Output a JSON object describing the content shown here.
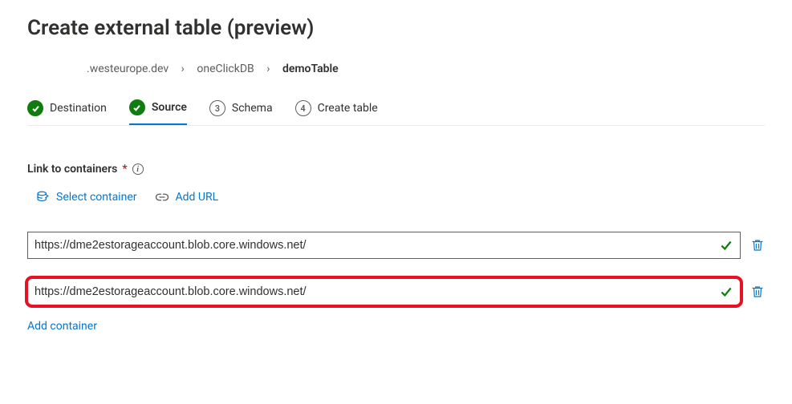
{
  "title": "Create external table (preview)",
  "breadcrumb": {
    "cluster": ".westeurope.dev",
    "database": "oneClickDB",
    "table": "demoTable"
  },
  "steps": {
    "destination": "Destination",
    "source": "Source",
    "schema": "Schema",
    "create_table": "Create table",
    "schema_num": "3",
    "create_num": "4"
  },
  "section": {
    "label": "Link to containers",
    "required_mark": "*"
  },
  "actions": {
    "select_container": "Select container",
    "add_url": "Add URL"
  },
  "containers": {
    "row1": "https://dme2estorageaccount.blob.core.windows.net/",
    "row2": "https://dme2estorageaccount.blob.core.windows.net/"
  },
  "add_container": "Add container"
}
